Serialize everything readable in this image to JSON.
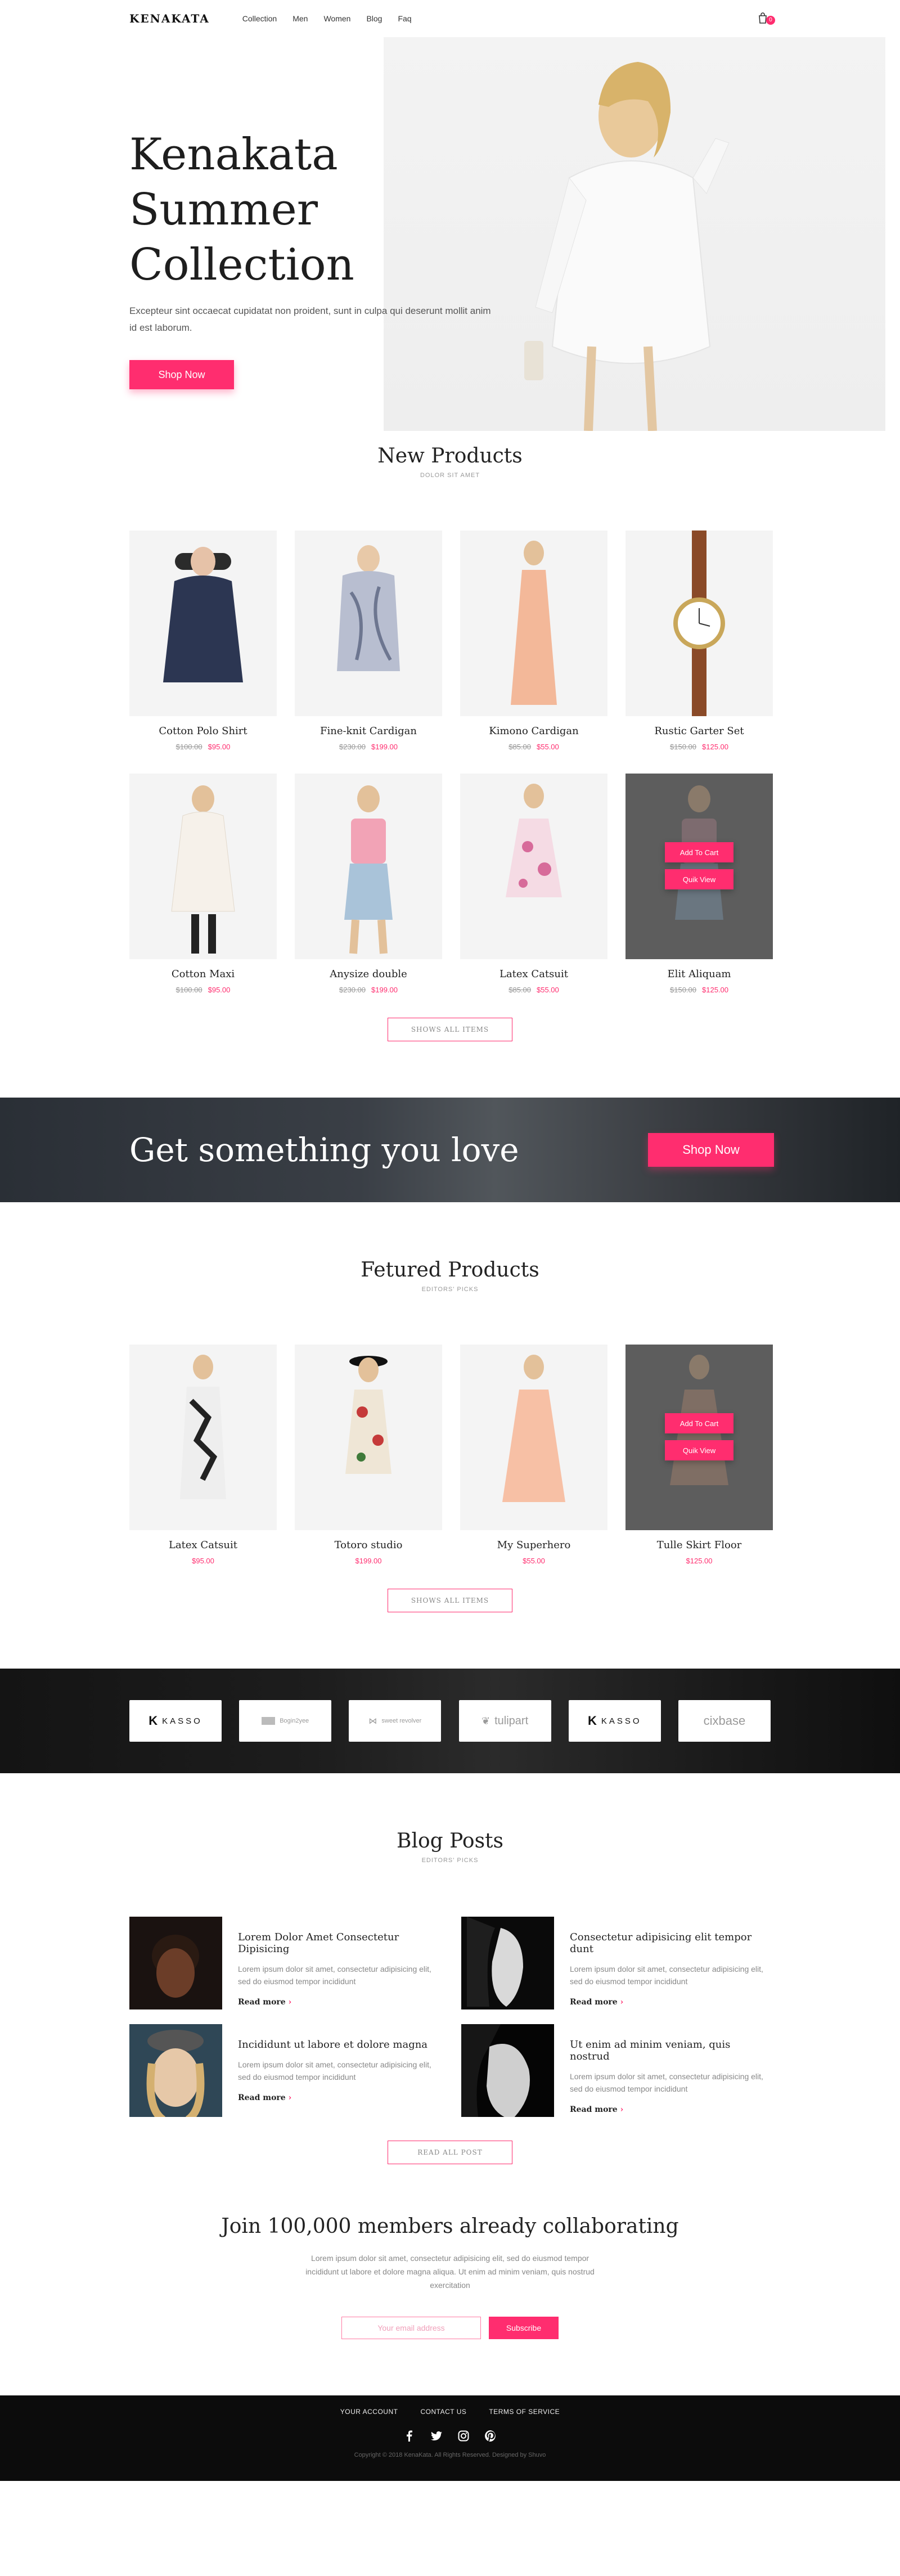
{
  "header": {
    "logo": "KENAKATA",
    "nav": [
      "Collection",
      "Men",
      "Women",
      "Blog",
      "Faq"
    ],
    "cart_count": "0"
  },
  "hero": {
    "title_line1": "Kenakata Summer",
    "title_line2": "Collection",
    "subtitle": "Excepteur sint occaecat cupidatat non proident, sunt in culpa qui deserunt mollit anim id est laborum.",
    "button": "Shop Now"
  },
  "new_products": {
    "title": "New Products",
    "subtitle": "DOLOR SIT AMET",
    "items": [
      {
        "name": "Cotton Polo Shirt",
        "old_price": "$100.00",
        "price": "$95.00"
      },
      {
        "name": "Fine-knit Cardigan",
        "old_price": "$230.00",
        "price": "$199.00"
      },
      {
        "name": "Kimono Cardigan",
        "old_price": "$85.00",
        "price": "$55.00"
      },
      {
        "name": "Rustic Garter Set",
        "old_price": "$150.00",
        "price": "$125.00"
      },
      {
        "name": "Cotton Maxi",
        "old_price": "$100.00",
        "price": "$95.00"
      },
      {
        "name": "Anysize double",
        "old_price": "$230.00",
        "price": "$199.00"
      },
      {
        "name": "Latex Catsuit",
        "old_price": "$85.00",
        "price": "$55.00"
      },
      {
        "name": "Elit Aliquam",
        "old_price": "$150.00",
        "price": "$125.00"
      }
    ],
    "add_to_cart": "Add To Cart",
    "quick_view": "Quik View",
    "show_all": "SHOWS ALL ITEMS"
  },
  "banner": {
    "title": "Get something you love",
    "button": "Shop Now"
  },
  "featured": {
    "title": "Fetured Products",
    "subtitle": "EDITORS' PICKS",
    "items": [
      {
        "name": "Latex Catsuit",
        "price": "$95.00"
      },
      {
        "name": "Totoro studio",
        "price": "$199.00"
      },
      {
        "name": "My Superhero",
        "price": "$55.00"
      },
      {
        "name": "Tulle Skirt Floor",
        "price": "$125.00"
      }
    ],
    "add_to_cart": "Add To Cart",
    "quick_view": "Quik View",
    "show_all": "SHOWS ALL ITEMS"
  },
  "brands": [
    "KASSO",
    "Bogin2yee",
    "sweet revolver",
    "tulipart",
    "KASSO",
    "cixbase"
  ],
  "blog": {
    "title": "Blog Posts",
    "subtitle": "EDITORS' PICKS",
    "posts": [
      {
        "title": "Lorem Dolor Amet Consectetur Dipisicing",
        "text": "Lorem ipsum dolor sit amet, consectetur adipisicing elit, sed do eiusmod tempor incididunt",
        "more": "Read more"
      },
      {
        "title": "Consectetur adipisicing elit tempor dunt",
        "text": "Lorem ipsum dolor sit amet, consectetur adipisicing elit, sed do eiusmod tempor incididunt",
        "more": "Read more"
      },
      {
        "title": "Incididunt ut labore et dolore magna",
        "text": "Lorem ipsum dolor sit amet, consectetur adipisicing elit, sed do eiusmod tempor incididunt",
        "more": "Read more"
      },
      {
        "title": "Ut enim ad minim veniam, quis nostrud",
        "text": "Lorem ipsum dolor sit amet, consectetur adipisicing elit, sed do eiusmod tempor incididunt",
        "more": "Read more"
      }
    ],
    "read_all": "READ ALL POST"
  },
  "join": {
    "title": "Join 100,000 members already collaborating",
    "text": "Lorem ipsum dolor sit amet, consectetur adipisicing elit, sed do eiusmod tempor incididunt ut labore et dolore magna aliqua. Ut enim ad minim veniam, quis nostrud exercitation",
    "placeholder": "Your email address",
    "button": "Subscribe"
  },
  "footer": {
    "links": [
      "YOUR ACCOUNT",
      "CONTACT US",
      "TERMS OF SERVICE"
    ],
    "copyright": "Copyright © 2018 KenaKata. All Rights Reserved. Designed by Shuvo"
  },
  "colors": {
    "accent": "#ff2d6f",
    "dark": "#0c0c0c"
  }
}
